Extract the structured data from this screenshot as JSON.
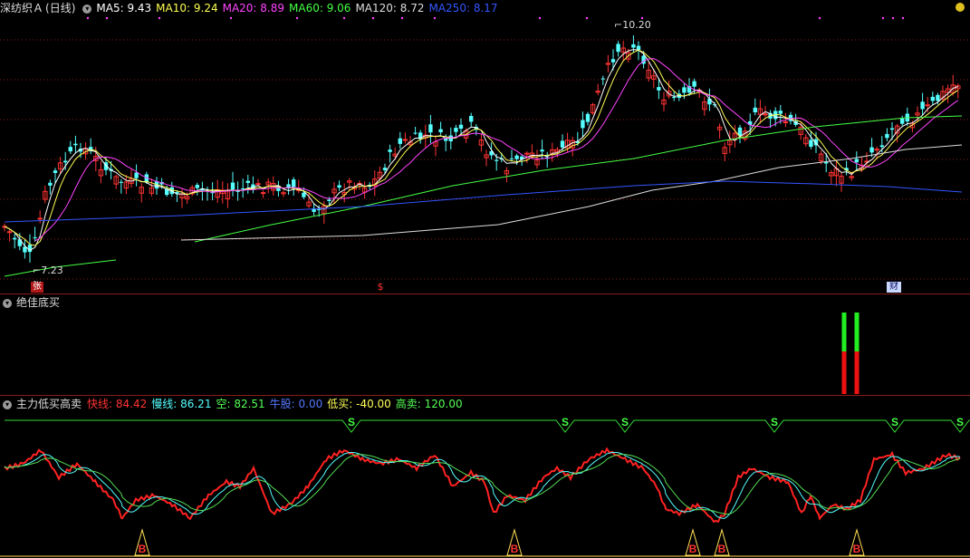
{
  "main": {
    "symbol": "深纺织Ａ",
    "period": "(日线)",
    "ma": [
      {
        "label": "MA5: ",
        "value": "9.43",
        "color": "#ffffff"
      },
      {
        "label": "MA10: ",
        "value": "9.24",
        "color": "#ffff55"
      },
      {
        "label": "MA20: ",
        "value": "8.89",
        "color": "#ff44ff"
      },
      {
        "label": "MA60: ",
        "value": "9.06",
        "color": "#44ff44"
      },
      {
        "label": "MA120: ",
        "value": "8.72",
        "color": "#dddddd"
      },
      {
        "label": "MA250: ",
        "value": "8.17",
        "color": "#3355ff"
      }
    ],
    "high_label": "10.20",
    "low_label": "7.23",
    "markers": [
      "张",
      "$",
      "财"
    ],
    "colors": {
      "up": "#ff3333",
      "down": "#55ffff"
    }
  },
  "ind1": {
    "title": "绝佳底买"
  },
  "ind2": {
    "title": "主力低买高卖",
    "values": [
      {
        "label": "快线: ",
        "value": "84.42",
        "color": "#ff3333"
      },
      {
        "label": "慢线: ",
        "value": "86.21",
        "color": "#55ffff"
      },
      {
        "label": "空: ",
        "value": "82.51",
        "color": "#55ff55"
      },
      {
        "label": "牛股: ",
        "value": "0.00",
        "color": "#5577ff"
      },
      {
        "label": "低买: ",
        "value": "-40.00",
        "color": "#ffff55"
      },
      {
        "label": "高卖: ",
        "value": "120.00",
        "color": "#55ff55"
      }
    ],
    "s_mark": "S",
    "b_mark": "B"
  }
}
